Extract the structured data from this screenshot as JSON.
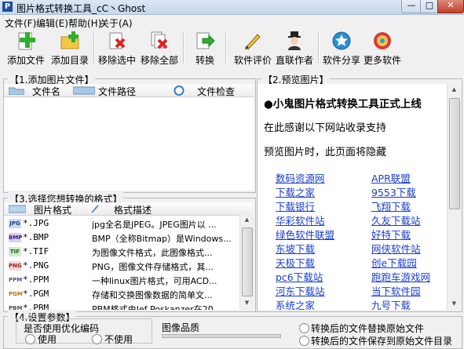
{
  "window": {
    "title": "图片格式转换工具_cC丶Ghost",
    "app_icon_letter": "P",
    "minimize": "—",
    "maximize": "□",
    "close": "✕"
  },
  "menu": [
    {
      "label": "文件(F)"
    },
    {
      "label": "编辑(E)"
    },
    {
      "label": "帮助(H)"
    },
    {
      "label": "关于(A)"
    }
  ],
  "toolbar": {
    "add_file": "添加文件",
    "add_dir": "添加目录",
    "remove_selected": "移除选中",
    "remove_all": "移除全部",
    "convert": "转换",
    "review": "软件评价",
    "author": "直联作者",
    "share": "软件分享",
    "more": "更多软件"
  },
  "add_images": {
    "title": "【1.添加图片文件】",
    "columns": [
      "文件名",
      "文件路径",
      "文件检查"
    ]
  },
  "preview": {
    "title": "【2.预览图片】",
    "heading": "●小鬼图片格式转换工具正式上线",
    "thanks": "在此感谢以下网站收录支持",
    "note": "预览图片时，此页面将隐藏",
    "links_left": [
      "数码资源网",
      "下载之家",
      "下载银行",
      "华彩软件站",
      "绿色软件联盟",
      "东坡下载",
      "天极下载",
      "pc6下载站",
      "河东下载站",
      "系统之家"
    ],
    "links_right": [
      "APR联盟",
      "9553下载",
      "飞翔下载",
      "久友下载站",
      "好特下载",
      "网侠软件站",
      "创e下载园",
      "跑跑车游戏网",
      "当下软件园",
      "九号下载"
    ]
  },
  "formats": {
    "title": "【3.选择您想转换的格式】",
    "columns": [
      "图片格式",
      "格式描述"
    ],
    "rows": [
      {
        "icon": "JPG",
        "name": "*.JPG",
        "desc": "jpg全名是JPEG。JPEG图片以 ..."
      },
      {
        "icon": "BMP",
        "name": "*.BMP",
        "desc": "BMP（全称Bitmap）是Windows..."
      },
      {
        "icon": "TIF",
        "name": "*.TIF",
        "desc": "为图像文件格式，此图像格式..."
      },
      {
        "icon": "PNG",
        "name": "*.PNG",
        "desc": "PNG，图像文件存储格式，其..."
      },
      {
        "icon": "PPM",
        "name": "*.PPM",
        "desc": "一种linux图片格式，可用ACD..."
      },
      {
        "icon": "PGM",
        "name": "*.PGM",
        "desc": "存储和交换图像数据的简单文..."
      },
      {
        "icon": "PBM",
        "name": "*.PBM",
        "desc": "PBM格式由Jef Poskanzer在20..."
      }
    ]
  },
  "settings": {
    "title": "【4.设置参数】",
    "optimize_label": "是否使用优化编码",
    "use": "使用",
    "not_use": "不使用",
    "quality_label": "图像品质",
    "replace_option": "转换后的文件替换原始文件",
    "other_option": "转换后的文件保存到原始文件目录"
  }
}
